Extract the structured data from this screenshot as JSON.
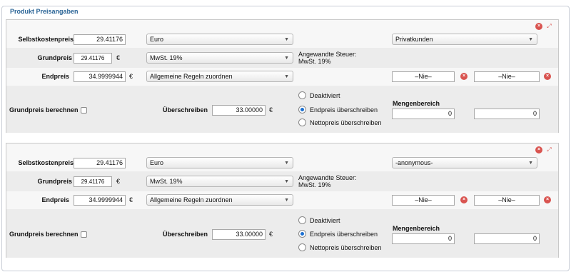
{
  "fieldset": {
    "legend": "Produkt Preisangaben"
  },
  "blocks": [
    {
      "selbstkosten_label": "Selbstkostenpreis",
      "selbstkosten_value": "29.41176",
      "currency": "Euro",
      "customer_group": "Privatkunden",
      "grundpreis_label": "Grundpreis",
      "grundpreis_value": "29.41176",
      "grundpreis_unit": "€",
      "tax_select": "MwSt. 19%",
      "applied_tax_label": "Angewandte Steuer:",
      "applied_tax_value": "MwSt. 19%",
      "endpreis_label": "Endpreis",
      "endpreis_value": "34.9999944",
      "endpreis_unit": "€",
      "rules_select": "Allgemeine Regeln zuordnen",
      "date_from": "–Nie–",
      "date_to": "–Nie–",
      "grundpreis_berechnen": "Grundpreis berechnen",
      "ueberschreiben_label": "Überschreiben",
      "ueberschreiben_value": "33.00000",
      "ueberschreiben_unit": "€",
      "radio_deaktiviert": "Deaktiviert",
      "radio_endpreis": "Endpreis überschreiben",
      "radio_nettopreis": "Nettopreis überschreiben",
      "mengenbereich_label": "Mengenbereich",
      "mengen_from": "0",
      "mengen_to": "0"
    },
    {
      "selbstkosten_label": "Selbstkostenpreis",
      "selbstkosten_value": "29.41176",
      "currency": "Euro",
      "customer_group": "-anonymous-",
      "grundpreis_label": "Grundpreis",
      "grundpreis_value": "29.41176",
      "grundpreis_unit": "€",
      "tax_select": "MwSt. 19%",
      "applied_tax_label": "Angewandte Steuer:",
      "applied_tax_value": "MwSt. 19%",
      "endpreis_label": "Endpreis",
      "endpreis_value": "34.9999944",
      "endpreis_unit": "€",
      "rules_select": "Allgemeine Regeln zuordnen",
      "date_from": "–Nie–",
      "date_to": "–Nie–",
      "grundpreis_berechnen": "Grundpreis berechnen",
      "ueberschreiben_label": "Überschreiben",
      "ueberschreiben_value": "33.00000",
      "ueberschreiben_unit": "€",
      "radio_deaktiviert": "Deaktiviert",
      "radio_endpreis": "Endpreis überschreiben",
      "radio_nettopreis": "Nettopreis überschreiben",
      "mengenbereich_label": "Mengenbereich",
      "mengen_from": "0",
      "mengen_to": "0"
    }
  ],
  "icons": {
    "remove": "remove-icon",
    "expand": "expand-icon",
    "calendar_clear": "calendar-clear-icon",
    "dropdown": "chevron-down-icon"
  },
  "colors": {
    "legend": "#2a6496",
    "remove_icon": "#d9534f",
    "radio_selected": "#1a6fd1",
    "row_alt": "#ececec"
  }
}
